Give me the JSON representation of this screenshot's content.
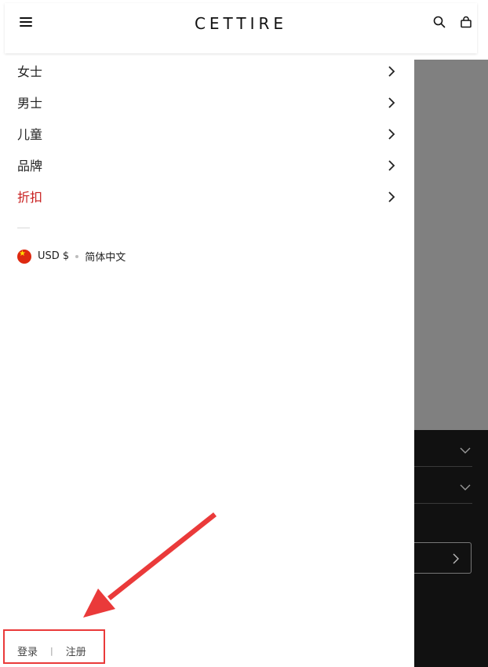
{
  "header": {
    "logo": "CETTIRE",
    "icons": {
      "menu": "hamburger-menu-icon",
      "search": "search-icon",
      "bag": "shopping-bag-icon"
    }
  },
  "drawer": {
    "nav_items": [
      {
        "label": "女士"
      },
      {
        "label": "男士"
      },
      {
        "label": "儿童"
      },
      {
        "label": "品牌"
      },
      {
        "label": "折扣"
      }
    ],
    "locale": {
      "currency": "USD $",
      "language": "简体中文",
      "flag_icon": "china-flag-icon"
    },
    "account": {
      "login": "登录",
      "separator": "|",
      "register": "注册"
    }
  },
  "colors": {
    "sale_text": "#c81e1e",
    "annotation": "#ea3a3a",
    "background_gray": "#808080",
    "background_dark": "#111111"
  }
}
